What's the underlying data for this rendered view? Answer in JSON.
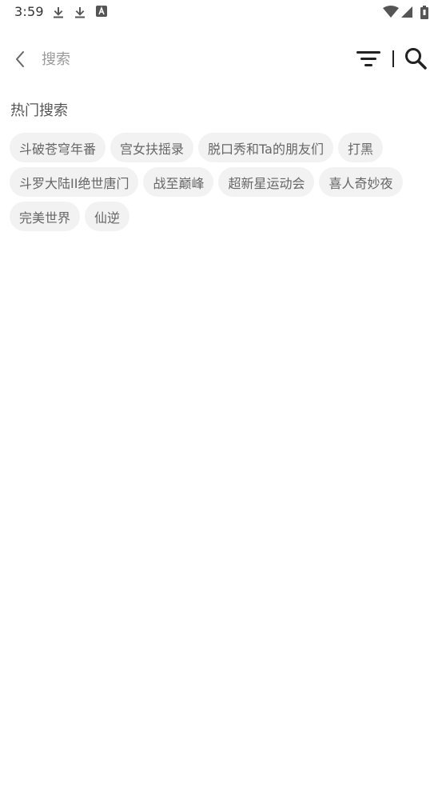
{
  "status_bar": {
    "time": "3:59",
    "left_icons": [
      "download-icon",
      "download-icon",
      "app-notification-icon"
    ],
    "right_icons": [
      "wifi-icon",
      "cell-signal-icon",
      "battery-icon"
    ]
  },
  "search_bar": {
    "placeholder": "搜索",
    "value": "",
    "back_icon": "chevron-left-icon",
    "filter_icon": "filter-icon",
    "search_icon": "search-icon"
  },
  "hot_search": {
    "title": "热门搜索",
    "tags": [
      "斗破苍穹年番",
      "宫女扶摇录",
      "脱口秀和Ta的朋友们",
      "打黑",
      "斗罗大陆II绝世唐门",
      "战至巅峰",
      "超新星运动会",
      "喜人奇妙夜",
      "完美世界",
      "仙逆"
    ]
  },
  "colors": {
    "background": "#ffffff",
    "tag_background": "#f2f2f2",
    "tag_text": "#666666",
    "placeholder": "#9a9a9a",
    "icon": "#222222"
  }
}
